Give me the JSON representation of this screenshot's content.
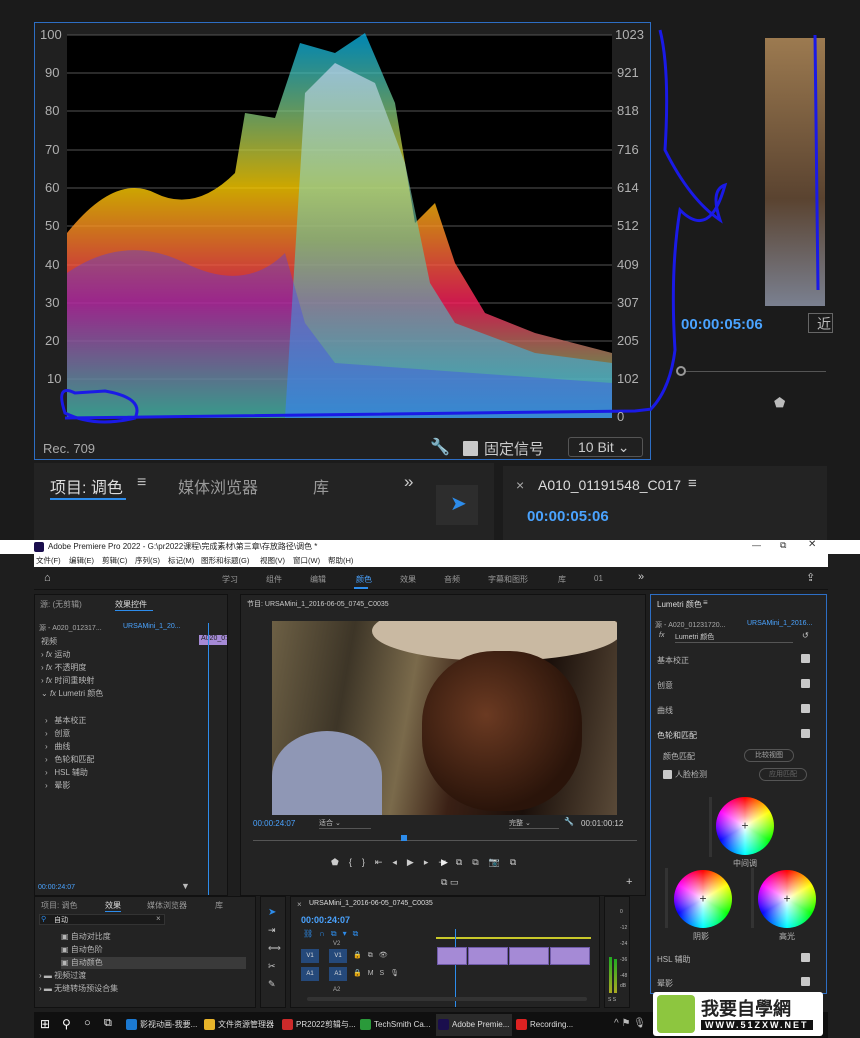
{
  "scope": {
    "left_labels": [
      "100",
      "90",
      "80",
      "70",
      "60",
      "50",
      "40",
      "30",
      "20",
      "10"
    ],
    "right_labels": [
      "1023",
      "921",
      "818",
      "716",
      "614",
      "512",
      "409",
      "307",
      "205",
      "102",
      "0"
    ],
    "colorspace": "Rec. 709",
    "lock_label": "固定信号",
    "bitdepth": "10 Bit"
  },
  "top_panel": {
    "tab_project": "项目: 调色",
    "tab_media": "媒体浏览器",
    "tab_lib": "库",
    "more": "»",
    "timecode": "00:00:05:06",
    "clip_name": "A010_01191548_C017",
    "timecode2": "00:00:05:06",
    "cut_text": "近"
  },
  "app": {
    "title": "Adobe Premiere Pro 2022 - G:\\pr2022课程\\完成素材\\第三章\\存放路径\\调色 *",
    "menus": [
      "文件(F)",
      "编辑(E)",
      "剪辑(C)",
      "序列(S)",
      "标记(M)",
      "图形和标题(G)",
      "视图(V)",
      "窗口(W)",
      "帮助(H)"
    ],
    "workspaces": [
      "学习",
      "组件",
      "编辑",
      "颜色",
      "效果",
      "音频",
      "字幕和图形",
      "库",
      "01"
    ],
    "active_workspace": "颜色"
  },
  "effects_panel": {
    "tab_source": "源: (无剪辑)",
    "tab_controls": "效果控件",
    "source_clip": "源 - A020_012317...",
    "seq_clip": "URSAMini_1_20...",
    "clip_label": "A020_0:",
    "section": "视频",
    "items": [
      "运动",
      "不透明度",
      "时间重映射",
      "Lumetri 颜色"
    ],
    "sub_items": [
      "基本校正",
      "创意",
      "曲线",
      "色轮和匹配",
      "HSL 辅助",
      "晕影"
    ],
    "timecode": "00:00:24:07"
  },
  "program": {
    "title": "节目: URSAMini_1_2016-06-05_0745_C0035",
    "timecode": "00:00:24:07",
    "fit": "适合",
    "quality": "完整",
    "duration": "00:01:00:12"
  },
  "lumetri": {
    "title": "Lumetri 颜色",
    "source": "源 - A020_01231720...",
    "seq": "URSAMini_1_2016...",
    "fx_label": "Lumetri 颜色",
    "sections": [
      "基本校正",
      "创意",
      "曲线",
      "色轮和匹配"
    ],
    "color_match": "颜色匹配",
    "compare_btn": "比较视图",
    "face_detect": "人脸检测",
    "apply_btn": "应用匹配",
    "wheel_mid": "中间调",
    "wheel_shadow": "阴影",
    "wheel_high": "高光",
    "hsl": "HSL 辅助",
    "vignette": "晕影"
  },
  "project": {
    "tab1": "项目: 调色",
    "tab2": "效果",
    "tab3": "媒体浏览器",
    "tab4": "库",
    "search": "自动",
    "items": [
      "自动对比度",
      "自动色阶",
      "自动颜色"
    ],
    "folders": [
      "视频过渡",
      "无缝转场预设合集"
    ]
  },
  "timeline": {
    "title": "URSAMini_1_2016-06-05_0745_C0035",
    "timecode": "00:00:24:07",
    "tracks": [
      "V2",
      "V1",
      "A1",
      "A2"
    ],
    "meter_labels": [
      "0",
      "-12",
      "-24",
      "-36",
      "-48",
      "dB"
    ],
    "meter_ss": "S  S"
  },
  "taskbar": {
    "items": [
      "影视动画-我要...",
      "文件资源管理器",
      "PR2022剪辑与...",
      "TechSmith Ca...",
      "Adobe Premie...",
      "Recording..."
    ]
  },
  "watermark": {
    "text": "我要自學網",
    "url": "WWW.51ZXW.NET"
  },
  "colors": {
    "accent": "#2d8ceb",
    "scope_border": "#2d6ec4",
    "annotation": "#1a1ae6",
    "purple_clip": "#a58ad6"
  }
}
